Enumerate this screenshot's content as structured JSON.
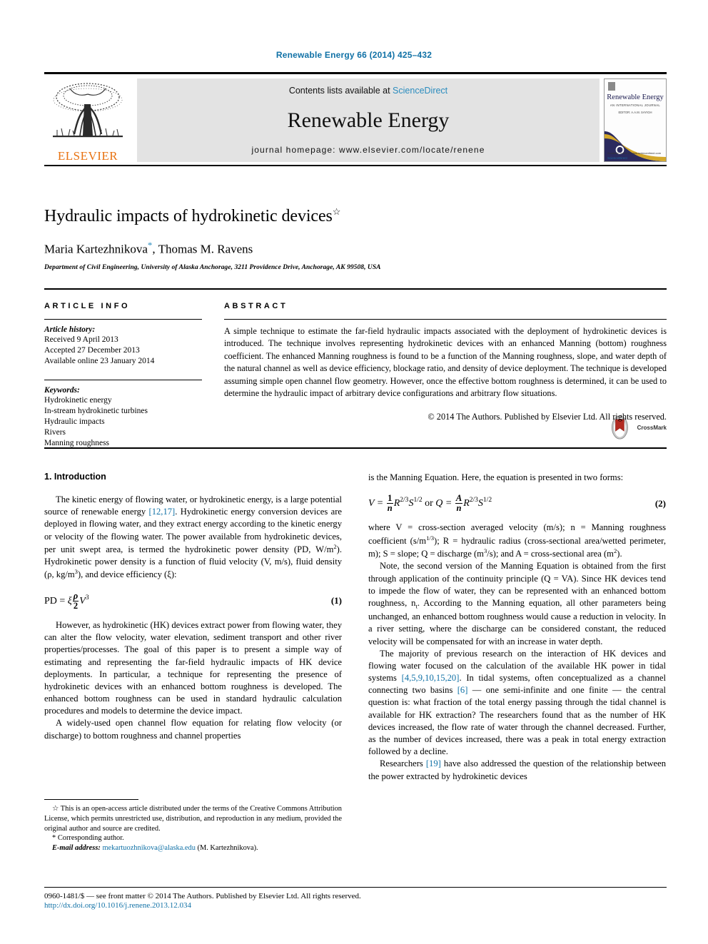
{
  "running_head": "Renewable Energy 66 (2014) 425–432",
  "masthead": {
    "publisher_name": "ELSEVIER",
    "publisher_logo_icon": "elsevier-tree-logo",
    "contents_prefix": "Contents lists available at",
    "contents_link": "ScienceDirect",
    "journal_title": "Renewable Energy",
    "homepage_line": "journal homepage: www.elsevier.com/locate/renene",
    "cover": {
      "title": "Renewable Energy",
      "subtitle": "AN INTERNATIONAL JOURNAL",
      "subtitle2": "EDITOR: A.A.M. SAYIGH",
      "footer_text": "Available online at www.sciencedirect.com",
      "footer_link": "ScienceDirect"
    }
  },
  "article": {
    "title": "Hydraulic impacts of hydrokinetic devices",
    "title_footnote_mark": "☆",
    "authors": "Maria Kartezhnikova",
    "author_mark": "*",
    "authors_rest": ", Thomas M. Ravens",
    "affiliation": "Department of Civil Engineering, University of Alaska Anchorage, 3211 Providence Drive, Anchorage, AK 99508, USA",
    "crossmark_label": "CrossMark",
    "crossmark_icon": "crossmark-badge-icon"
  },
  "article_info": {
    "heading": "ARTICLE INFO",
    "history_label": "Article history:",
    "history": [
      "Received 9 April 2013",
      "Accepted 27 December 2013",
      "Available online 23 January 2014"
    ],
    "keywords_label": "Keywords:",
    "keywords": [
      "Hydrokinetic energy",
      "In-stream hydrokinetic turbines",
      "Hydraulic impacts",
      "Rivers",
      "Manning roughness"
    ]
  },
  "abstract": {
    "heading": "ABSTRACT",
    "text": "A simple technique to estimate the far-field hydraulic impacts associated with the deployment of hydrokinetic devices is introduced. The technique involves representing hydrokinetic devices with an enhanced Manning (bottom) roughness coefficient. The enhanced Manning roughness is found to be a function of the Manning roughness, slope, and water depth of the natural channel as well as device efficiency, blockage ratio, and density of device deployment. The technique is developed assuming simple open channel flow geometry. However, once the effective bottom roughness is determined, it can be used to determine the hydraulic impact of arbitrary device configurations and arbitrary flow situations.",
    "copyright": "© 2014 The Authors. Published by Elsevier Ltd. All rights reserved."
  },
  "body": {
    "section_number_title": "1.  Introduction",
    "left": {
      "p1_a": "The kinetic energy of flowing water, or hydrokinetic energy, is a large potential source of renewable energy ",
      "p1_ref": "[12,17]",
      "p1_b": ". Hydrokinetic energy conversion devices are deployed in flowing water, and they extract energy according to the kinetic energy or velocity of the flowing water. The power available from hydrokinetic devices, per unit swept area, is termed the hydrokinetic power density (PD, W/m",
      "p1_sup": "2",
      "p1_c": "). Hydrokinetic power density is a function of fluid velocity (V, m/s), fluid density (ρ, kg/m",
      "p1_sup2": "3",
      "p1_d": "), and device efficiency (ξ):",
      "eq1_lhs": "PD  = ",
      "eq1_xi": "ξ",
      "eq1_num": "ρ",
      "eq1_den": "2",
      "eq1_rhs": "V",
      "eq1_exp": "3",
      "eq1_number": "(1)",
      "p2": "However, as hydrokinetic (HK) devices extract power from flowing water, they can alter the flow velocity, water elevation, sediment transport and other river properties/processes. The goal of this paper is to present a simple way of estimating and representing the far-field hydraulic impacts of HK device deployments. In particular, a technique for representing the presence of hydrokinetic devices with an enhanced bottom roughness is developed. The enhanced bottom roughness can be used in standard hydraulic calculation procedures and models to determine the device impact.",
      "p3": "A widely-used open channel flow equation for relating flow velocity (or discharge) to bottom roughness and channel properties"
    },
    "right": {
      "p4": "is the Manning Equation. Here, the equation is presented in two forms:",
      "eq2_v": "V  = ",
      "eq2_num1": "1",
      "eq2_den1": "n",
      "eq2_mid1": "R",
      "eq2_exp1": "2/3",
      "eq2_s1": "S",
      "eq2_sexp1": "1/2",
      "eq2_or": " or ",
      "eq2_q": "Q  = ",
      "eq2_num2": "A",
      "eq2_den2": "n",
      "eq2_mid2": "R",
      "eq2_exp2": "2/3",
      "eq2_s2": "S",
      "eq2_sexp2": "1/2",
      "eq2_number": "(2)",
      "p5_a": "where V = cross-section averaged velocity (m/s); n = Manning roughness coefficient (s/m",
      "p5_sup1": "1/3",
      "p5_b": "); R = hydraulic radius (cross-sectional area/wetted perimeter, m); S = slope; Q = discharge (m",
      "p5_sup2": "3",
      "p5_c": "/s); and A = cross-sectional area (m",
      "p5_sup3": "2",
      "p5_d": ").",
      "p6_a": "Note, the second version of the Manning Equation is obtained from the first through application of the continuity principle (Q = VA). Since HK devices tend to impede the flow of water, they can be represented with an enhanced bottom roughness, n",
      "p6_sub": "t",
      "p6_b": ". According to the Manning equation, all other parameters being unchanged, an enhanced bottom roughness would cause a reduction in velocity. In a river setting, where the discharge can be considered constant, the reduced velocity will be compensated for with an increase in water depth.",
      "p7_a": "The majority of previous research on the interaction of HK devices and flowing water focused on the calculation of the available HK power in tidal systems ",
      "p7_ref1": "[4,5,9,10,15,20]",
      "p7_b": ". In tidal systems, often conceptualized as a channel connecting two basins ",
      "p7_ref2": "[6]",
      "p7_c": " — one semi-infinite and one finite — the central question is: what fraction of the total energy passing through the tidal channel is available for HK extraction? The researchers found that as the number of HK devices increased, the flow rate of water through the channel decreased. Further, as the number of devices increased, there was a peak in total energy extraction followed by a decline.",
      "p8_a": "Researchers ",
      "p8_ref": "[19]",
      "p8_b": " have also addressed the question of the relationship between the power extracted by hydrokinetic devices"
    }
  },
  "footnotes": {
    "open_access_mark": "☆",
    "open_access": "This is an open-access article distributed under the terms of the Creative Commons Attribution License, which permits unrestricted use, distribution, and reproduction in any medium, provided the original author and source are credited.",
    "corresponding_mark": "*",
    "corresponding": "Corresponding author.",
    "email_label": "E-mail address:",
    "email": "mekartuozhnikova@alaska.edu",
    "email_owner": "(M. Kartezhnikova)."
  },
  "page_footer": {
    "issn_line": "0960-1481/$ — see front matter © 2014 The Authors. Published by Elsevier Ltd. All rights reserved.",
    "doi_line": "http://dx.doi.org/10.1016/j.renene.2013.12.034"
  },
  "colors": {
    "link_blue": "#1071a6",
    "sciencedirect_blue": "#2b8cbe",
    "elsevier_orange": "#e87211",
    "banner_gray": "#e3e3e3"
  }
}
